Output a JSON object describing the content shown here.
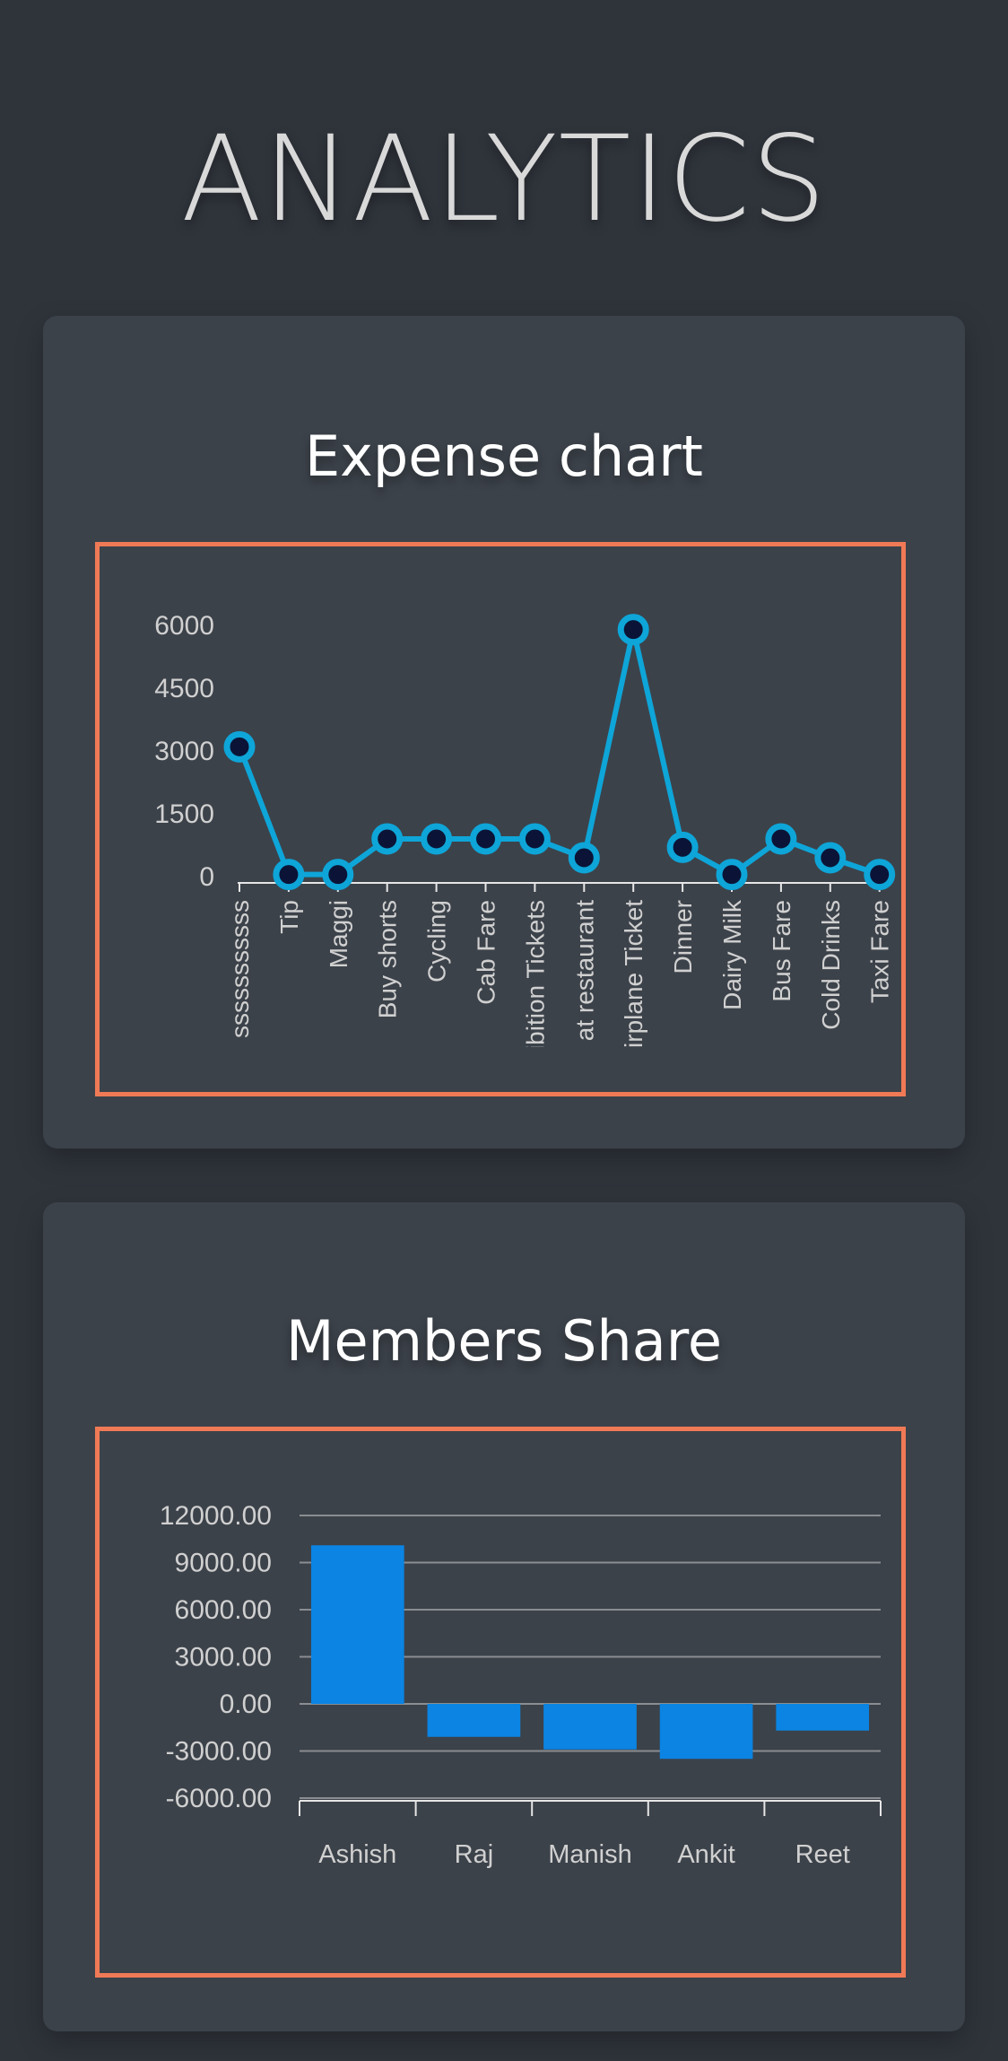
{
  "page": {
    "title": "ANALYTICS"
  },
  "colors": {
    "frame": "#f07a56",
    "line": "#0ea5d8",
    "point_fill": "#0b1437",
    "bar": "#0b84e3",
    "card": "#3c424a",
    "bg": "#2f343b"
  },
  "chart_data": [
    {
      "type": "line",
      "title": "Expense chart",
      "categories": [
        "sssssssssss",
        "Tip",
        "Maggi",
        "Buy shorts",
        "Cycling",
        "Cab Fare",
        "xhibition Tickets",
        "at restaurant",
        "Airplane Ticket",
        "Dinner",
        "Dairy Milk",
        "Bus Fare",
        "Cold Drinks",
        "Taxi Fare"
      ],
      "values": [
        3100,
        50,
        50,
        900,
        900,
        900,
        900,
        450,
        5900,
        700,
        50,
        900,
        450,
        50
      ],
      "yticks": [
        "6000",
        "4500",
        "3000",
        "1500",
        "0"
      ],
      "ylim": [
        0,
        6000
      ],
      "xlabel": "",
      "ylabel": ""
    },
    {
      "type": "bar",
      "title": "Members Share",
      "categories": [
        "Ashish",
        "Raj",
        "Manish",
        "Ankit",
        "Reet"
      ],
      "values": [
        10100,
        -2100,
        -2900,
        -3500,
        -1700
      ],
      "yticks": [
        "12000.00",
        "9000.00",
        "6000.00",
        "3000.00",
        "0.00",
        "-3000.00",
        "-6000.00"
      ],
      "ylim": [
        -6000,
        12000
      ],
      "grid": true,
      "xlabel": "",
      "ylabel": ""
    }
  ]
}
